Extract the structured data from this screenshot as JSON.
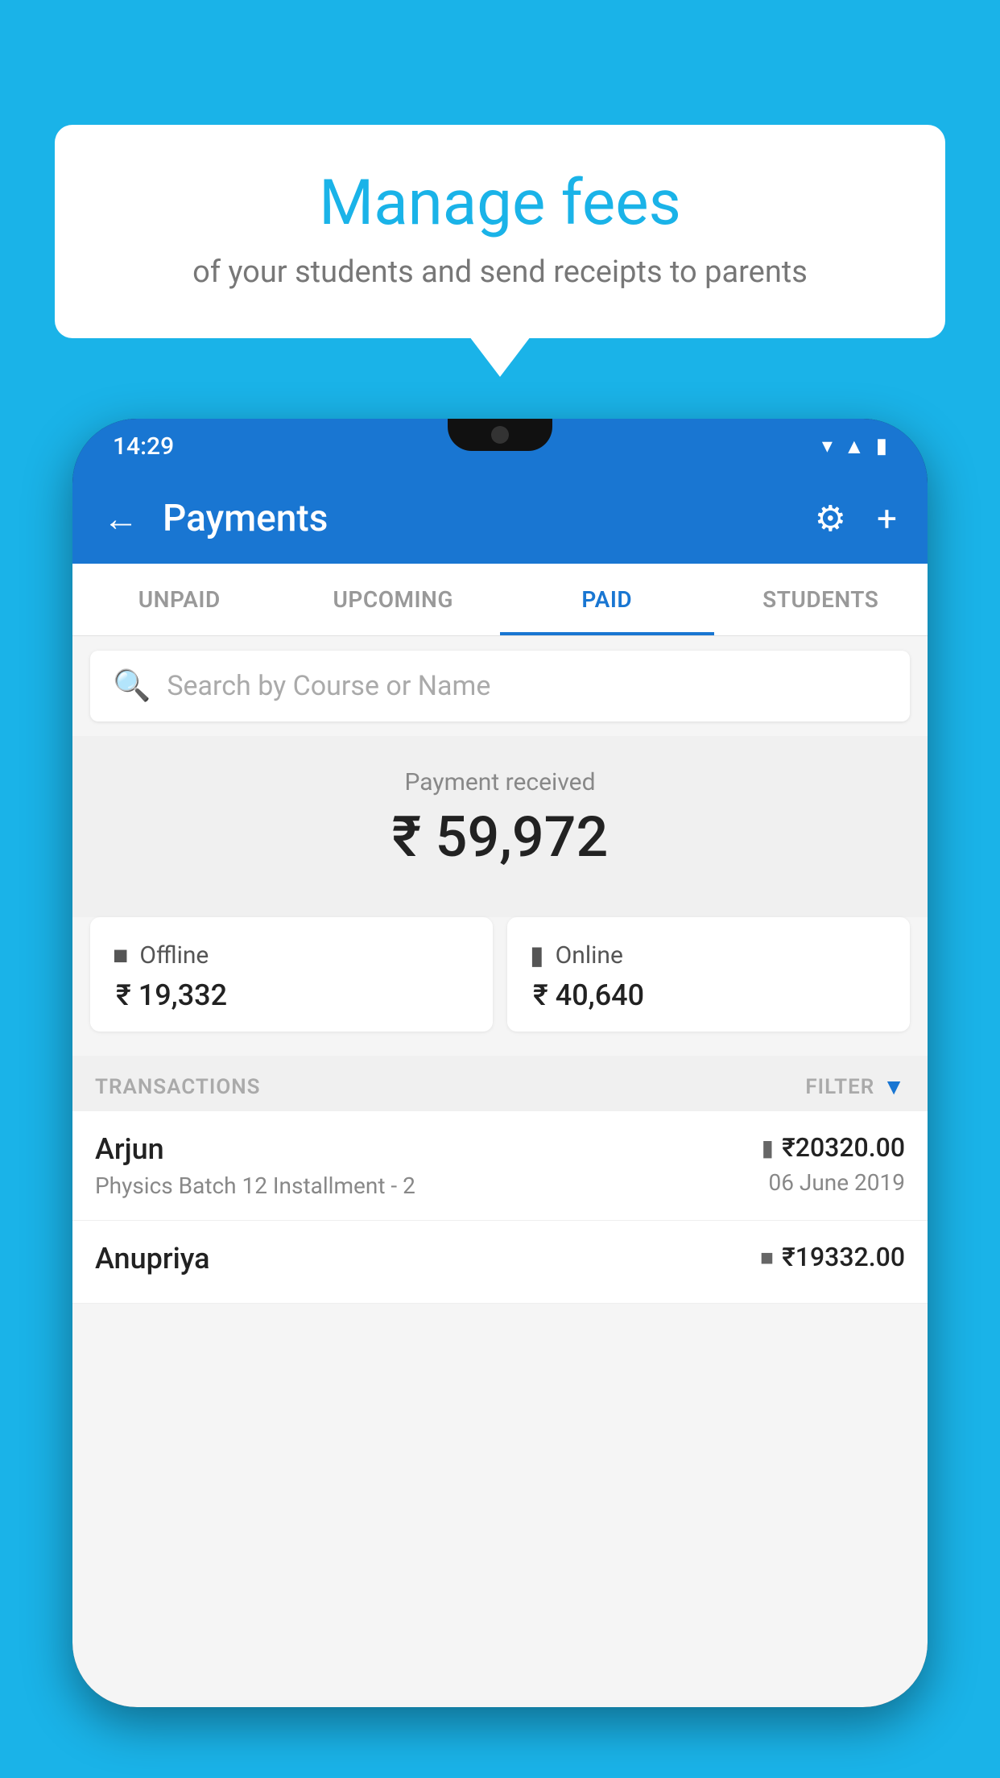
{
  "background": {
    "color": "#1ab3e8"
  },
  "bubble": {
    "title": "Manage fees",
    "subtitle": "of your students and send receipts to parents"
  },
  "statusBar": {
    "time": "14:29",
    "icons": [
      "wifi",
      "signal",
      "battery"
    ]
  },
  "appBar": {
    "title": "Payments",
    "backLabel": "←",
    "gearLabel": "⚙",
    "plusLabel": "+"
  },
  "tabs": [
    {
      "label": "UNPAID",
      "active": false
    },
    {
      "label": "UPCOMING",
      "active": false
    },
    {
      "label": "PAID",
      "active": true
    },
    {
      "label": "STUDENTS",
      "active": false
    }
  ],
  "search": {
    "placeholder": "Search by Course or Name"
  },
  "paymentSection": {
    "label": "Payment received",
    "amount": "₹ 59,972",
    "offline": {
      "label": "Offline",
      "amount": "₹ 19,332"
    },
    "online": {
      "label": "Online",
      "amount": "₹ 40,640"
    }
  },
  "transactions": {
    "headerLabel": "TRANSACTIONS",
    "filterLabel": "FILTER",
    "rows": [
      {
        "name": "Arjun",
        "detail": "Physics Batch 12 Installment - 2",
        "amountIcon": "card",
        "amount": "₹20320.00",
        "date": "06 June 2019"
      },
      {
        "name": "Anupriya",
        "detail": "",
        "amountIcon": "cash",
        "amount": "₹19332.00",
        "date": ""
      }
    ]
  }
}
